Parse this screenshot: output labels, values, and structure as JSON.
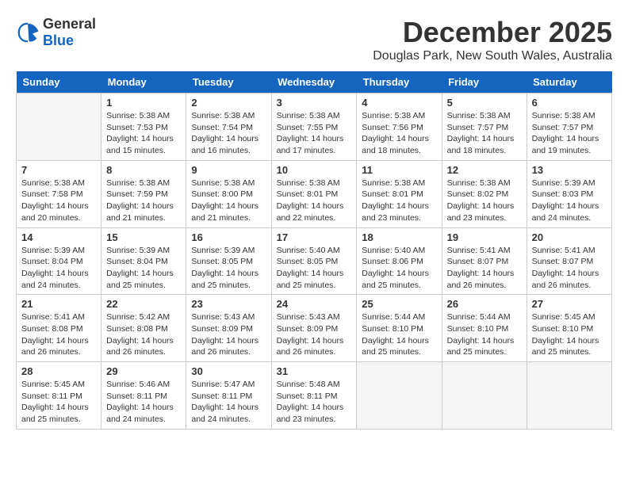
{
  "logo": {
    "text_general": "General",
    "text_blue": "Blue"
  },
  "title": {
    "month": "December 2025",
    "location": "Douglas Park, New South Wales, Australia"
  },
  "days_header": [
    "Sunday",
    "Monday",
    "Tuesday",
    "Wednesday",
    "Thursday",
    "Friday",
    "Saturday"
  ],
  "weeks": [
    [
      {
        "day": "",
        "sunrise": "",
        "sunset": "",
        "daylight": ""
      },
      {
        "day": "1",
        "sunrise": "Sunrise: 5:38 AM",
        "sunset": "Sunset: 7:53 PM",
        "daylight": "Daylight: 14 hours and 15 minutes."
      },
      {
        "day": "2",
        "sunrise": "Sunrise: 5:38 AM",
        "sunset": "Sunset: 7:54 PM",
        "daylight": "Daylight: 14 hours and 16 minutes."
      },
      {
        "day": "3",
        "sunrise": "Sunrise: 5:38 AM",
        "sunset": "Sunset: 7:55 PM",
        "daylight": "Daylight: 14 hours and 17 minutes."
      },
      {
        "day": "4",
        "sunrise": "Sunrise: 5:38 AM",
        "sunset": "Sunset: 7:56 PM",
        "daylight": "Daylight: 14 hours and 18 minutes."
      },
      {
        "day": "5",
        "sunrise": "Sunrise: 5:38 AM",
        "sunset": "Sunset: 7:57 PM",
        "daylight": "Daylight: 14 hours and 18 minutes."
      },
      {
        "day": "6",
        "sunrise": "Sunrise: 5:38 AM",
        "sunset": "Sunset: 7:57 PM",
        "daylight": "Daylight: 14 hours and 19 minutes."
      }
    ],
    [
      {
        "day": "7",
        "sunrise": "Sunrise: 5:38 AM",
        "sunset": "Sunset: 7:58 PM",
        "daylight": "Daylight: 14 hours and 20 minutes."
      },
      {
        "day": "8",
        "sunrise": "Sunrise: 5:38 AM",
        "sunset": "Sunset: 7:59 PM",
        "daylight": "Daylight: 14 hours and 21 minutes."
      },
      {
        "day": "9",
        "sunrise": "Sunrise: 5:38 AM",
        "sunset": "Sunset: 8:00 PM",
        "daylight": "Daylight: 14 hours and 21 minutes."
      },
      {
        "day": "10",
        "sunrise": "Sunrise: 5:38 AM",
        "sunset": "Sunset: 8:01 PM",
        "daylight": "Daylight: 14 hours and 22 minutes."
      },
      {
        "day": "11",
        "sunrise": "Sunrise: 5:38 AM",
        "sunset": "Sunset: 8:01 PM",
        "daylight": "Daylight: 14 hours and 23 minutes."
      },
      {
        "day": "12",
        "sunrise": "Sunrise: 5:38 AM",
        "sunset": "Sunset: 8:02 PM",
        "daylight": "Daylight: 14 hours and 23 minutes."
      },
      {
        "day": "13",
        "sunrise": "Sunrise: 5:39 AM",
        "sunset": "Sunset: 8:03 PM",
        "daylight": "Daylight: 14 hours and 24 minutes."
      }
    ],
    [
      {
        "day": "14",
        "sunrise": "Sunrise: 5:39 AM",
        "sunset": "Sunset: 8:04 PM",
        "daylight": "Daylight: 14 hours and 24 minutes."
      },
      {
        "day": "15",
        "sunrise": "Sunrise: 5:39 AM",
        "sunset": "Sunset: 8:04 PM",
        "daylight": "Daylight: 14 hours and 25 minutes."
      },
      {
        "day": "16",
        "sunrise": "Sunrise: 5:39 AM",
        "sunset": "Sunset: 8:05 PM",
        "daylight": "Daylight: 14 hours and 25 minutes."
      },
      {
        "day": "17",
        "sunrise": "Sunrise: 5:40 AM",
        "sunset": "Sunset: 8:05 PM",
        "daylight": "Daylight: 14 hours and 25 minutes."
      },
      {
        "day": "18",
        "sunrise": "Sunrise: 5:40 AM",
        "sunset": "Sunset: 8:06 PM",
        "daylight": "Daylight: 14 hours and 25 minutes."
      },
      {
        "day": "19",
        "sunrise": "Sunrise: 5:41 AM",
        "sunset": "Sunset: 8:07 PM",
        "daylight": "Daylight: 14 hours and 26 minutes."
      },
      {
        "day": "20",
        "sunrise": "Sunrise: 5:41 AM",
        "sunset": "Sunset: 8:07 PM",
        "daylight": "Daylight: 14 hours and 26 minutes."
      }
    ],
    [
      {
        "day": "21",
        "sunrise": "Sunrise: 5:41 AM",
        "sunset": "Sunset: 8:08 PM",
        "daylight": "Daylight: 14 hours and 26 minutes."
      },
      {
        "day": "22",
        "sunrise": "Sunrise: 5:42 AM",
        "sunset": "Sunset: 8:08 PM",
        "daylight": "Daylight: 14 hours and 26 minutes."
      },
      {
        "day": "23",
        "sunrise": "Sunrise: 5:43 AM",
        "sunset": "Sunset: 8:09 PM",
        "daylight": "Daylight: 14 hours and 26 minutes."
      },
      {
        "day": "24",
        "sunrise": "Sunrise: 5:43 AM",
        "sunset": "Sunset: 8:09 PM",
        "daylight": "Daylight: 14 hours and 26 minutes."
      },
      {
        "day": "25",
        "sunrise": "Sunrise: 5:44 AM",
        "sunset": "Sunset: 8:10 PM",
        "daylight": "Daylight: 14 hours and 25 minutes."
      },
      {
        "day": "26",
        "sunrise": "Sunrise: 5:44 AM",
        "sunset": "Sunset: 8:10 PM",
        "daylight": "Daylight: 14 hours and 25 minutes."
      },
      {
        "day": "27",
        "sunrise": "Sunrise: 5:45 AM",
        "sunset": "Sunset: 8:10 PM",
        "daylight": "Daylight: 14 hours and 25 minutes."
      }
    ],
    [
      {
        "day": "28",
        "sunrise": "Sunrise: 5:45 AM",
        "sunset": "Sunset: 8:11 PM",
        "daylight": "Daylight: 14 hours and 25 minutes."
      },
      {
        "day": "29",
        "sunrise": "Sunrise: 5:46 AM",
        "sunset": "Sunset: 8:11 PM",
        "daylight": "Daylight: 14 hours and 24 minutes."
      },
      {
        "day": "30",
        "sunrise": "Sunrise: 5:47 AM",
        "sunset": "Sunset: 8:11 PM",
        "daylight": "Daylight: 14 hours and 24 minutes."
      },
      {
        "day": "31",
        "sunrise": "Sunrise: 5:48 AM",
        "sunset": "Sunset: 8:11 PM",
        "daylight": "Daylight: 14 hours and 23 minutes."
      },
      {
        "day": "",
        "sunrise": "",
        "sunset": "",
        "daylight": ""
      },
      {
        "day": "",
        "sunrise": "",
        "sunset": "",
        "daylight": ""
      },
      {
        "day": "",
        "sunrise": "",
        "sunset": "",
        "daylight": ""
      }
    ]
  ]
}
